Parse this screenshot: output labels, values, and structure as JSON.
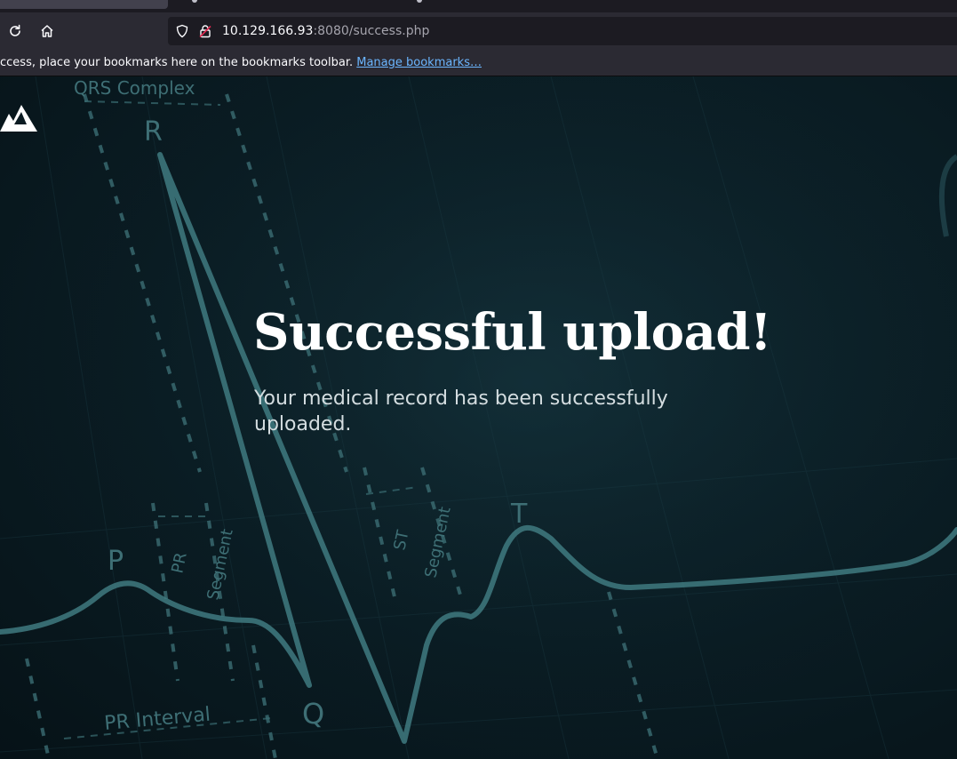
{
  "browser": {
    "url_host": "10.129.166.93",
    "url_path": ":8080/success.php",
    "bookmarks_message": "ccess, place your bookmarks here on the bookmarks toolbar. ",
    "bookmarks_link": "Manage bookmarks…",
    "icons": {
      "reload": "reload-icon",
      "home": "home-icon",
      "shield": "shield-icon",
      "lock": "insecure-lock-icon"
    }
  },
  "page": {
    "heading": "Successful upload!",
    "message": "Your medical record has been successfully uploaded.",
    "background_labels": {
      "qrs_complex": "QRS Complex",
      "r": "R",
      "p": "P",
      "pr_segment_1": "PR",
      "pr_segment_2": "Segment",
      "st_segment_1": "ST",
      "st_segment_2": "Segment",
      "t": "T",
      "q": "Q",
      "pr_interval": "PR Interval"
    }
  },
  "colors": {
    "accent_link": "#6bb6ff",
    "page_bg": "#0b1b22",
    "ecg_line": "#3f7a80"
  }
}
